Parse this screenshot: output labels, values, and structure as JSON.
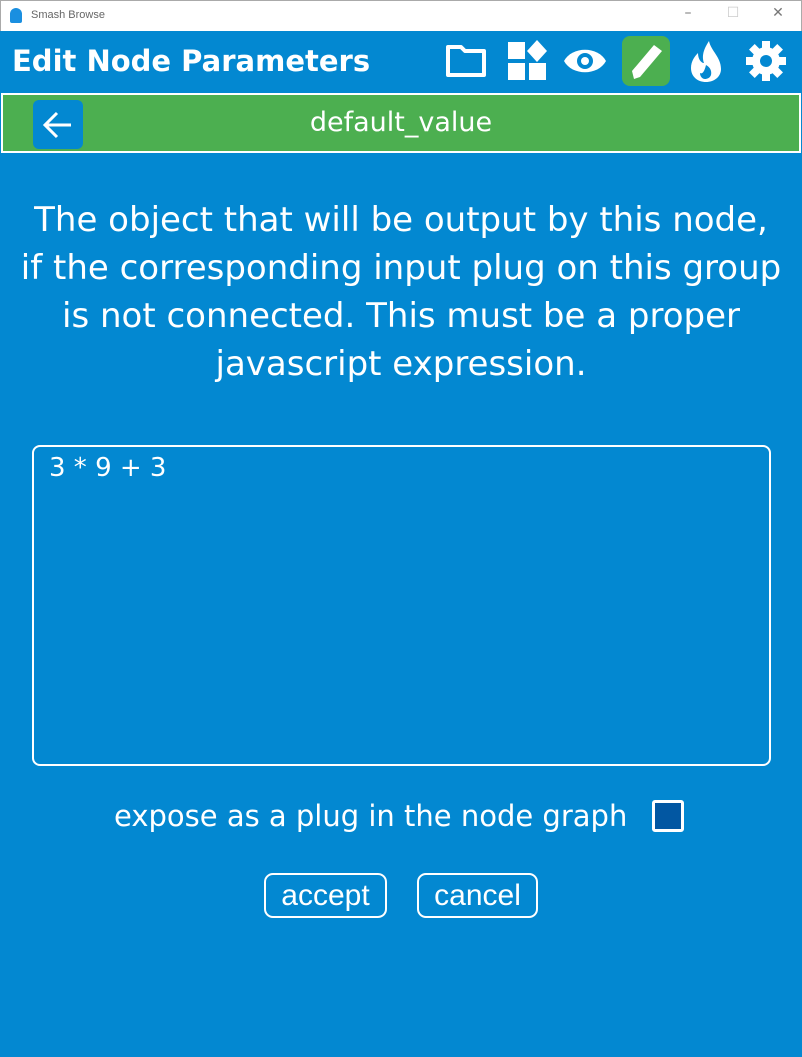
{
  "window": {
    "title": "Smash Browse"
  },
  "header": {
    "title": "Edit Node Parameters",
    "icons": [
      "folder-icon",
      "widgets-icon",
      "eye-icon",
      "pencil-icon",
      "flame-icon",
      "gear-icon"
    ],
    "active_icon": "pencil-icon"
  },
  "subheader": {
    "title": "default_value"
  },
  "description": "The object that will be output by this node, if the corresponding input plug on this group is not connected. This must be a proper javascript expression.",
  "editor": {
    "value": "3 * 9 + 3"
  },
  "expose": {
    "label": "expose as a plug in the node graph",
    "checked": false
  },
  "buttons": {
    "accept": "accept",
    "cancel": "cancel"
  },
  "colors": {
    "background": "#0388d1",
    "accent": "#4caf50"
  }
}
